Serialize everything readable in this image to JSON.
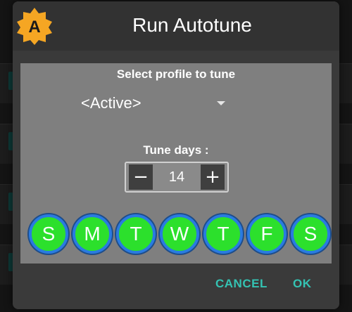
{
  "dialog": {
    "title": "Run Autotune",
    "logo_letter": "A",
    "logo_color": "#f5a623"
  },
  "profile": {
    "label": "Select profile to tune",
    "selected": "<Active>"
  },
  "tune_days": {
    "label": "Tune days :",
    "value": "14",
    "minus": "−",
    "plus": "+"
  },
  "weekdays": [
    "S",
    "M",
    "T",
    "W",
    "T",
    "F",
    "S"
  ],
  "actions": {
    "cancel": "CANCEL",
    "ok": "OK"
  },
  "colors": {
    "accent": "#34c3b3",
    "day_fill": "#2ce02c",
    "day_ring": "#2a7be0"
  }
}
